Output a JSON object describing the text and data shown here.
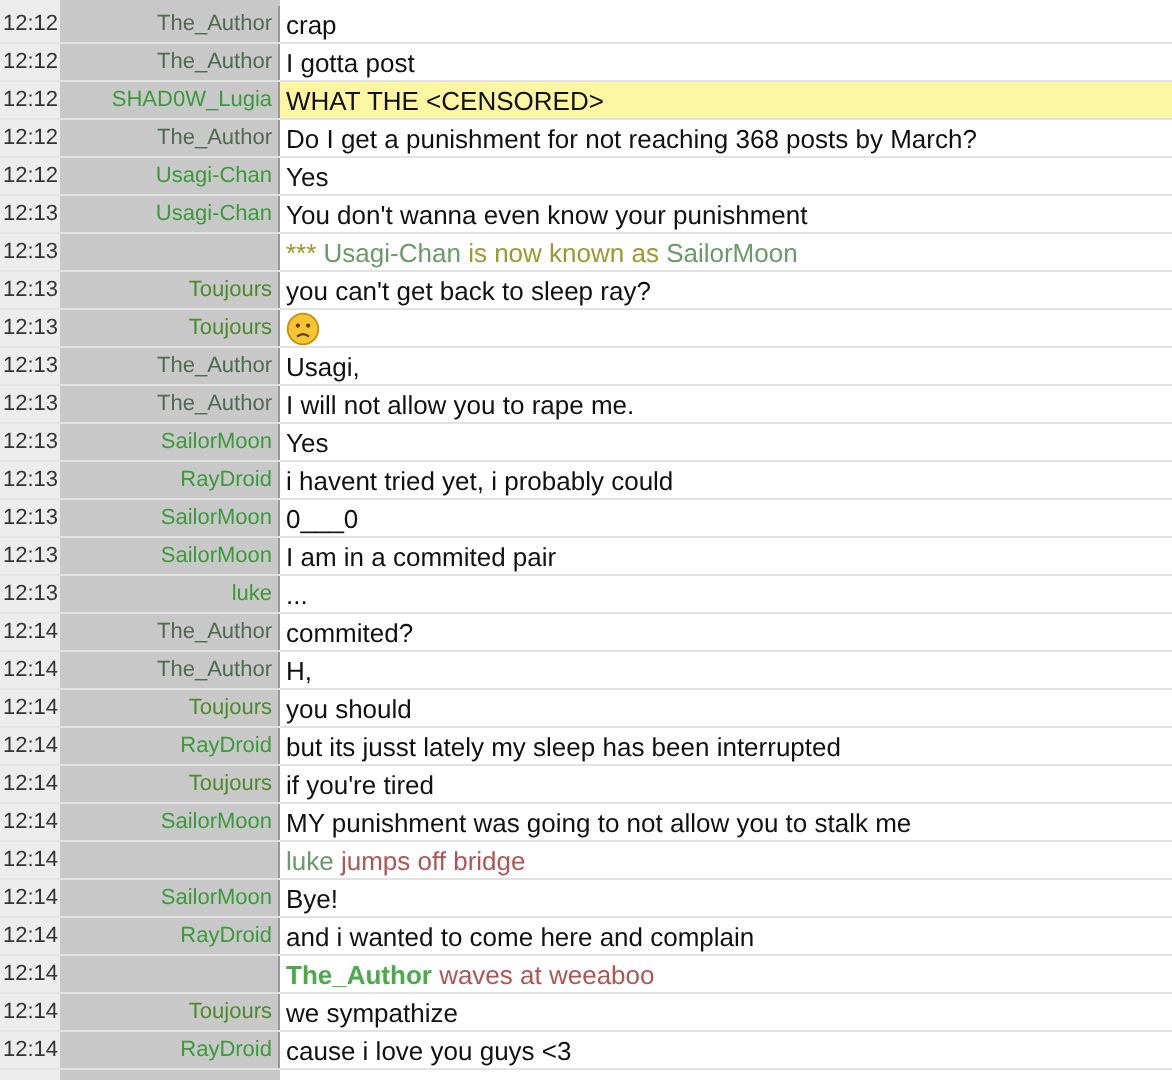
{
  "messages": [
    {
      "time": "12:12",
      "user": "The_Author",
      "color": "#506850",
      "kind": "message",
      "text": "crap",
      "highlighted": false
    },
    {
      "time": "12:12",
      "user": "The_Author",
      "color": "#506850",
      "kind": "message",
      "text": "I gotta post",
      "highlighted": false
    },
    {
      "time": "12:12",
      "user": "SHAD0W_Lugia",
      "color": "#3a9a3a",
      "kind": "message",
      "text": "WHAT THE <CENSORED>",
      "highlighted": true
    },
    {
      "time": "12:12",
      "user": "The_Author",
      "color": "#506850",
      "kind": "message",
      "text": "Do I get a punishment for not reaching 368 posts by March?",
      "highlighted": false
    },
    {
      "time": "12:12",
      "user": "Usagi-Chan",
      "color": "#3a9a3a",
      "kind": "message",
      "text": "Yes",
      "highlighted": false
    },
    {
      "time": "12:13",
      "user": "Usagi-Chan",
      "color": "#3a9a3a",
      "kind": "message",
      "text": "You don't wanna even know your punishment",
      "highlighted": false
    },
    {
      "time": "12:13",
      "kind": "notice",
      "highlighted": false,
      "parts": [
        {
          "text": "*** ",
          "kind": "marker"
        },
        {
          "text": "Usagi-Chan",
          "kind": "nick"
        },
        {
          "text": " is now known as ",
          "kind": "marker"
        },
        {
          "text": "SailorMoon",
          "kind": "nick"
        }
      ]
    },
    {
      "time": "12:13",
      "user": "Toujours",
      "color": "#4a8a2a",
      "kind": "message",
      "text": "you can't get back to sleep ray?",
      "highlighted": false
    },
    {
      "time": "12:13",
      "user": "Toujours",
      "color": "#4a8a2a",
      "kind": "emoji",
      "highlighted": false
    },
    {
      "time": "12:13",
      "user": "The_Author",
      "color": "#506850",
      "kind": "message",
      "text": "Usagi,",
      "highlighted": false
    },
    {
      "time": "12:13",
      "user": "The_Author",
      "color": "#506850",
      "kind": "message",
      "text": "I will not allow you to rape me.",
      "highlighted": false
    },
    {
      "time": "12:13",
      "user": "SailorMoon",
      "color": "#3a9a3a",
      "kind": "message",
      "text": "Yes",
      "highlighted": false
    },
    {
      "time": "12:13",
      "user": "RayDroid",
      "color": "#3a9a3a",
      "kind": "message",
      "text": "i havent tried yet, i probably could",
      "highlighted": false
    },
    {
      "time": "12:13",
      "user": "SailorMoon",
      "color": "#3a9a3a",
      "kind": "message",
      "text": "0___0",
      "highlighted": false
    },
    {
      "time": "12:13",
      "user": "SailorMoon",
      "color": "#3a9a3a",
      "kind": "message",
      "text": "I am in a commited pair",
      "highlighted": false
    },
    {
      "time": "12:13",
      "user": "luke",
      "color": "#3a9a3a",
      "kind": "message",
      "text": "...",
      "highlighted": false
    },
    {
      "time": "12:14",
      "user": "The_Author",
      "color": "#506850",
      "kind": "message",
      "text": "commited?",
      "highlighted": false
    },
    {
      "time": "12:14",
      "user": "The_Author",
      "color": "#506850",
      "kind": "message",
      "text": "H,",
      "highlighted": false
    },
    {
      "time": "12:14",
      "user": "Toujours",
      "color": "#4a8a2a",
      "kind": "message",
      "text": "you should",
      "highlighted": false
    },
    {
      "time": "12:14",
      "user": "RayDroid",
      "color": "#3a9a3a",
      "kind": "message",
      "text": "but its jusst lately my sleep has been interrupted",
      "highlighted": false
    },
    {
      "time": "12:14",
      "user": "Toujours",
      "color": "#4a8a2a",
      "kind": "message",
      "text": "if you're tired",
      "highlighted": false
    },
    {
      "time": "12:14",
      "user": "SailorMoon",
      "color": "#3a9a3a",
      "kind": "message",
      "text": "MY punishment was going to not allow you to stalk me",
      "highlighted": false
    },
    {
      "time": "12:14",
      "kind": "notice",
      "highlighted": false,
      "parts": [
        {
          "text": "luke",
          "kind": "nick"
        },
        {
          "text": " jumps off bridge",
          "kind": "action"
        }
      ]
    },
    {
      "time": "12:14",
      "user": "SailorMoon",
      "color": "#3a9a3a",
      "kind": "message",
      "text": "Bye!",
      "highlighted": false
    },
    {
      "time": "12:14",
      "user": "RayDroid",
      "color": "#3a9a3a",
      "kind": "message",
      "text": "and i wanted to come here and complain",
      "highlighted": false
    },
    {
      "time": "12:14",
      "kind": "notice",
      "highlighted": false,
      "parts": [
        {
          "text": "The_Author",
          "kind": "actor"
        },
        {
          "text": " waves at weeaboo",
          "kind": "action"
        }
      ]
    },
    {
      "time": "12:14",
      "user": "Toujours",
      "color": "#4a8a2a",
      "kind": "message",
      "text": "we sympathize",
      "highlighted": false
    },
    {
      "time": "12:14",
      "user": "RayDroid",
      "color": "#3a9a3a",
      "kind": "message",
      "text": "cause i love you guys <3",
      "highlighted": false
    }
  ]
}
